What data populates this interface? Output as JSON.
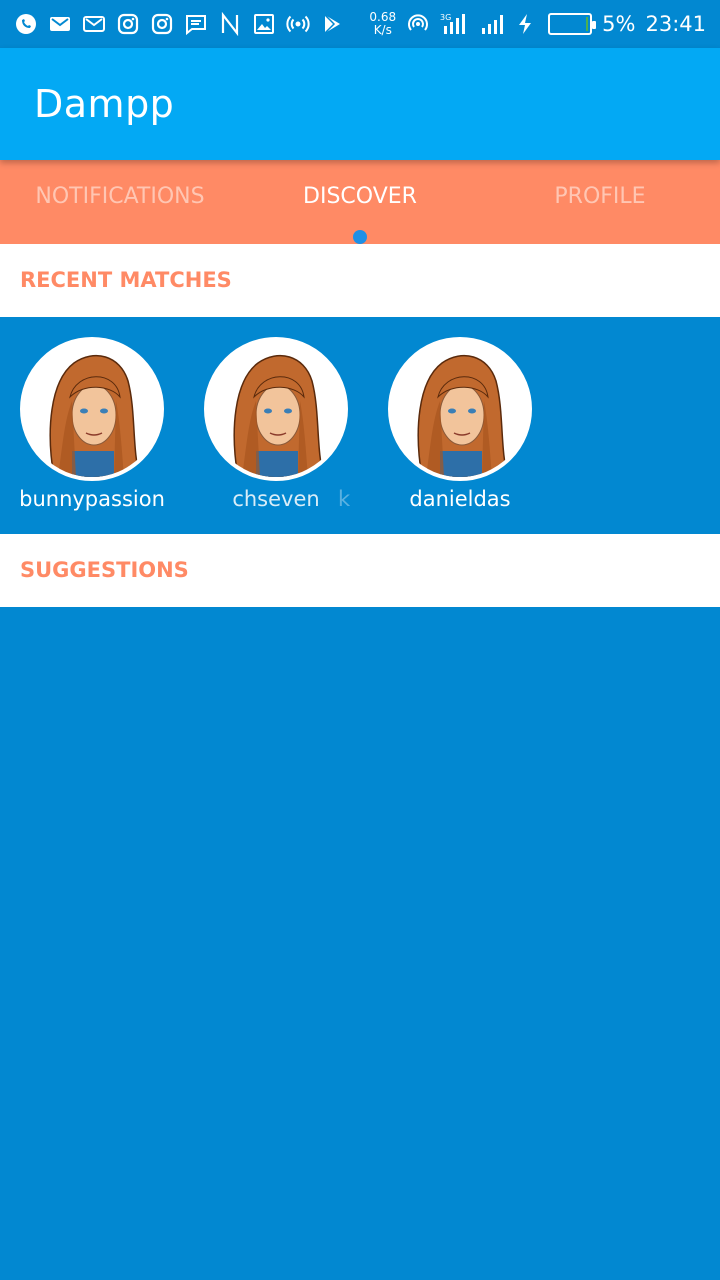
{
  "status": {
    "net_speed_value": "0.68",
    "net_speed_unit": "K/s",
    "network_type": "3G",
    "battery_percent": "5%",
    "battery_level": 0.05,
    "time": "23:41",
    "icons": [
      "whatsapp-icon",
      "gmail-icon",
      "gmail-outline-icon",
      "instagram-icon",
      "instagram-icon",
      "message-icon",
      "n-icon",
      "image-icon",
      "broadcast-icon",
      "play-store-icon"
    ]
  },
  "app": {
    "title": "Dampp"
  },
  "tabs": [
    {
      "label": "NOTIFICATIONS"
    },
    {
      "label": "DISCOVER"
    },
    {
      "label": "PROFILE"
    }
  ],
  "sections": {
    "recent_matches": "RECENT MATCHES",
    "suggestions": "SUGGESTIONS"
  },
  "matches": [
    {
      "name": "bunnypassion"
    },
    {
      "name": "chseven"
    },
    {
      "name": "danieldas"
    }
  ],
  "matches_partial_text": "k",
  "colors": {
    "status_bar": "#0288d1",
    "app_bar": "#03a9f4",
    "tabs": "#ff8a65",
    "accent_dot": "#1e90e6",
    "section_title": "#ff8a65",
    "background": "#0288d1"
  }
}
